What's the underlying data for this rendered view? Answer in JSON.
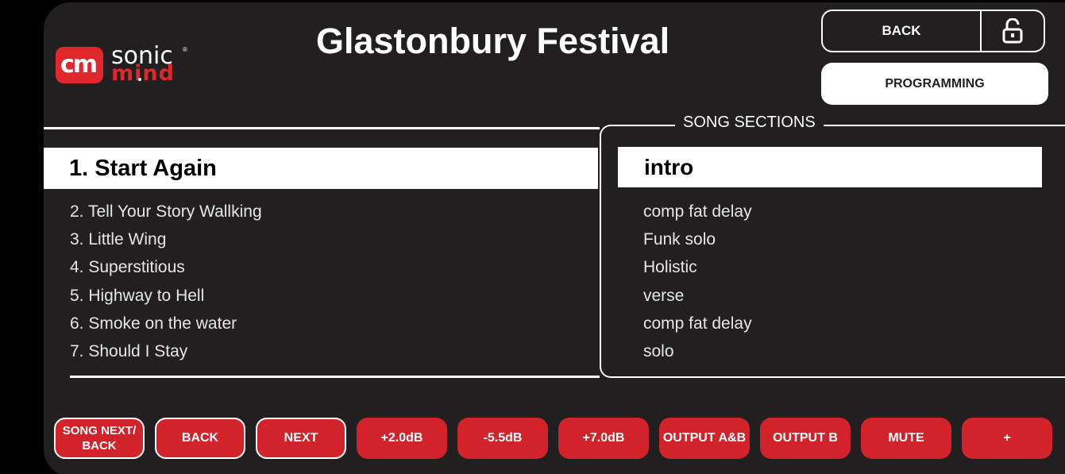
{
  "logo": {
    "mark": "cm",
    "brand_top": "sonic",
    "brand_bottom": "mind",
    "registered": "®"
  },
  "header": {
    "title": "Glastonbury Festival",
    "back_label": "BACK",
    "lock_icon": "unlocked-padlock-icon",
    "programming_label": "PROGRAMMING"
  },
  "songs": {
    "current": "1. Start Again",
    "items": [
      "2. Tell Your Story Wallking",
      "3. Little Wing",
      "4. Superstitious",
      "5. Highway to Hell",
      "6. Smoke on the water",
      "7. Should I Stay"
    ]
  },
  "sections": {
    "legend": "SONG SECTIONS",
    "current": "intro",
    "items": [
      "comp fat delay",
      "Funk solo",
      "Holistic",
      "verse",
      "comp fat delay",
      "solo"
    ]
  },
  "bottom_buttons": [
    {
      "label": "SONG NEXT/\nBACK",
      "style": "outlined"
    },
    {
      "label": "BACK",
      "style": "outlined"
    },
    {
      "label": "NEXT",
      "style": "outlined"
    },
    {
      "label": "+2.0dB",
      "style": "filled"
    },
    {
      "label": "-5.5dB",
      "style": "filled"
    },
    {
      "label": "+7.0dB",
      "style": "filled"
    },
    {
      "label": "OUTPUT A&B",
      "style": "filled"
    },
    {
      "label": "OUTPUT B",
      "style": "filled"
    },
    {
      "label": "MUTE",
      "style": "filled"
    },
    {
      "label": "+",
      "style": "filled"
    }
  ],
  "colors": {
    "background": "#221f20",
    "accent": "#d3232a",
    "highlight": "#ffffff"
  }
}
